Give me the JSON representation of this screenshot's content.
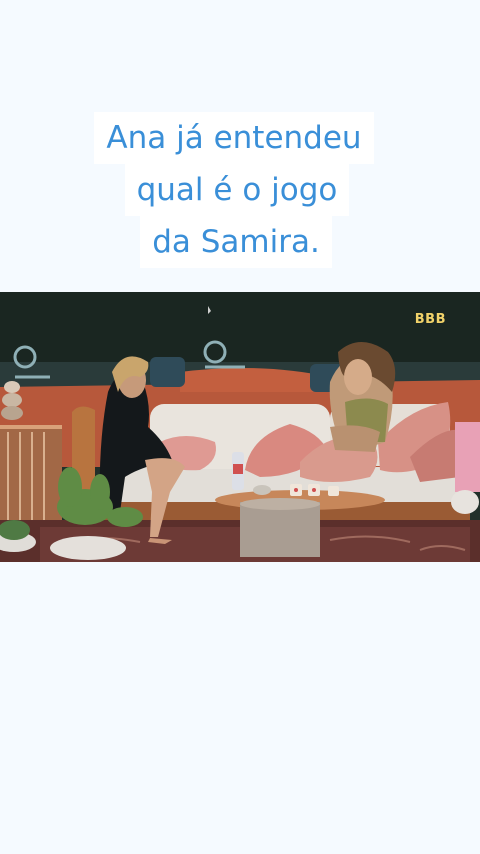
{
  "caption": {
    "line1": "Ana já entendeu",
    "line2": "qual é o jogo",
    "line3": "da Samira."
  },
  "video": {
    "logo_text": "BBB"
  },
  "colors": {
    "page_background": "#f5faff",
    "caption_text": "#3a8fd8",
    "caption_background": "#ffffff",
    "logo": "#f1d26a"
  }
}
